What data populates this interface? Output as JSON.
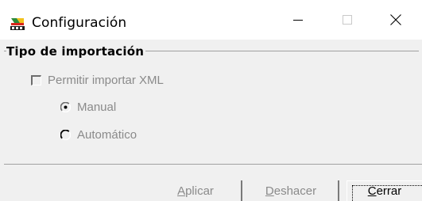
{
  "window": {
    "title": "Configuración",
    "icon": "set-app-icon",
    "controls": {
      "minimize": "minimize-icon",
      "maximize": "maximize-icon",
      "close": "close-icon"
    }
  },
  "group": {
    "title": "Tipo de importación",
    "checkbox": {
      "label": "Permitir importar XML",
      "checked": false,
      "enabled": false
    },
    "radios": [
      {
        "label": "Manual",
        "selected": true,
        "enabled": false
      },
      {
        "label": "Automático",
        "selected": false,
        "enabled": false
      }
    ]
  },
  "footer": {
    "aplicar": {
      "prefix": "",
      "mnemonic": "A",
      "rest": "plicar",
      "enabled": false
    },
    "deshacer": {
      "prefix": "",
      "mnemonic": "D",
      "rest": "eshacer",
      "enabled": false
    },
    "cerrar": {
      "prefix": "",
      "mnemonic": "C",
      "rest": "errar",
      "enabled": true,
      "focused": true
    }
  },
  "colors": {
    "disabled_text": "#8a8a8a",
    "dialog_bg": "#f0f0f0",
    "titlebar_bg": "#ffffff"
  }
}
